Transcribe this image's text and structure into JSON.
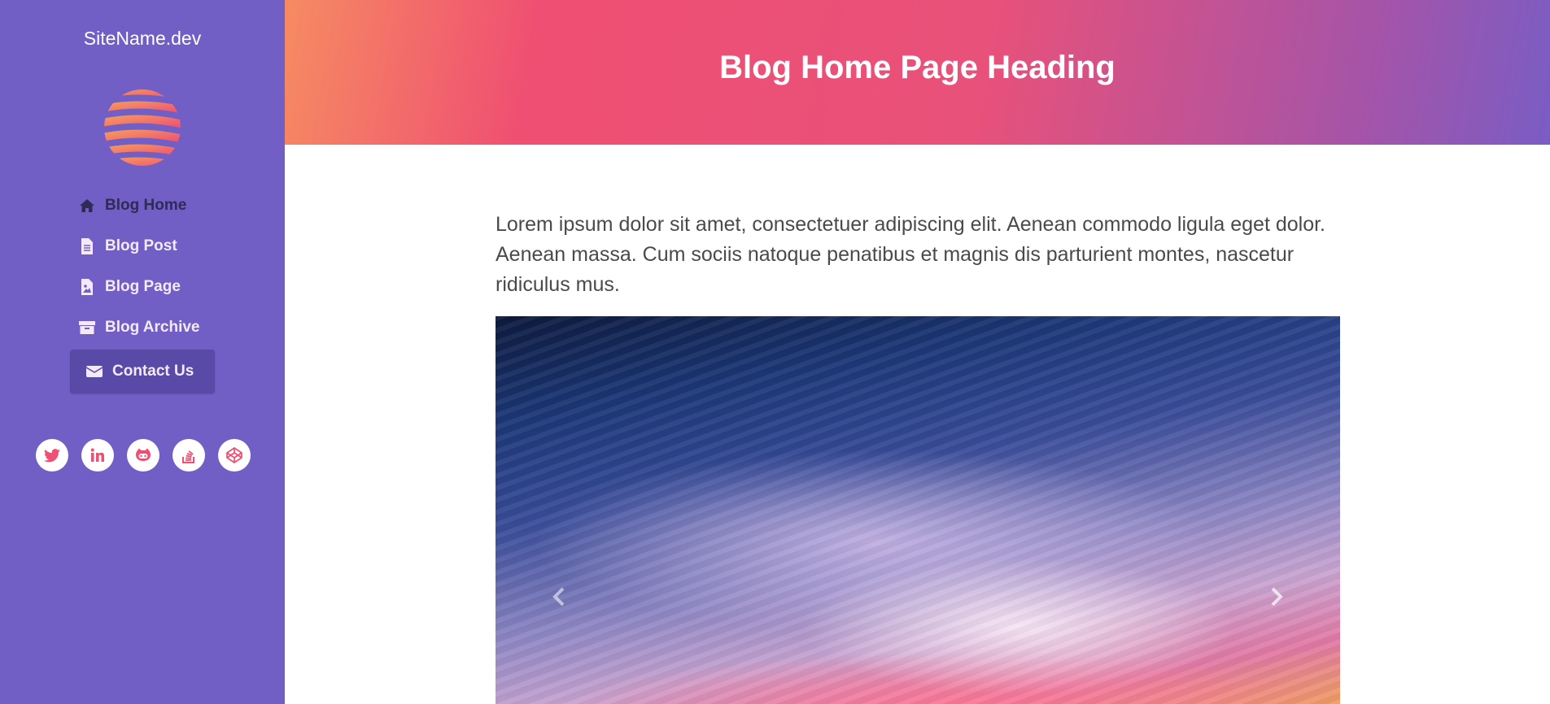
{
  "sidebar": {
    "site_name": "SiteName.dev",
    "logo_icon": "striped-globe-logo",
    "nav": [
      {
        "label": "Blog Home",
        "icon": "home-icon",
        "active": true
      },
      {
        "label": "Blog Post",
        "icon": "file-text-icon"
      },
      {
        "label": "Blog Page",
        "icon": "file-image-icon"
      },
      {
        "label": "Blog Archive",
        "icon": "archive-icon"
      },
      {
        "label": "Contact Us",
        "icon": "envelope-icon"
      }
    ],
    "social": [
      "twitter-icon",
      "linkedin-icon",
      "github-icon",
      "stack-overflow-icon",
      "codepen-icon"
    ]
  },
  "header": {
    "title": "Blog Home Page Heading"
  },
  "main": {
    "intro": "Lorem ipsum dolor sit amet, consectetuer adipiscing elit. Aenean commodo ligula eget dolor. Aenean massa. Cum sociis natoque penatibus et magnis dis parturient montes, nascetur ridiculus mus.",
    "carousel": {
      "prev_icon": "chevron-left-icon",
      "next_icon": "chevron-right-icon"
    }
  },
  "colors": {
    "sidebar_bg": "#715fc5",
    "accent_pink": "#ef4f72",
    "accent_orange": "#f68b62",
    "nav_active": "#2f2b57",
    "contact_bg": "#5a4aa8"
  }
}
